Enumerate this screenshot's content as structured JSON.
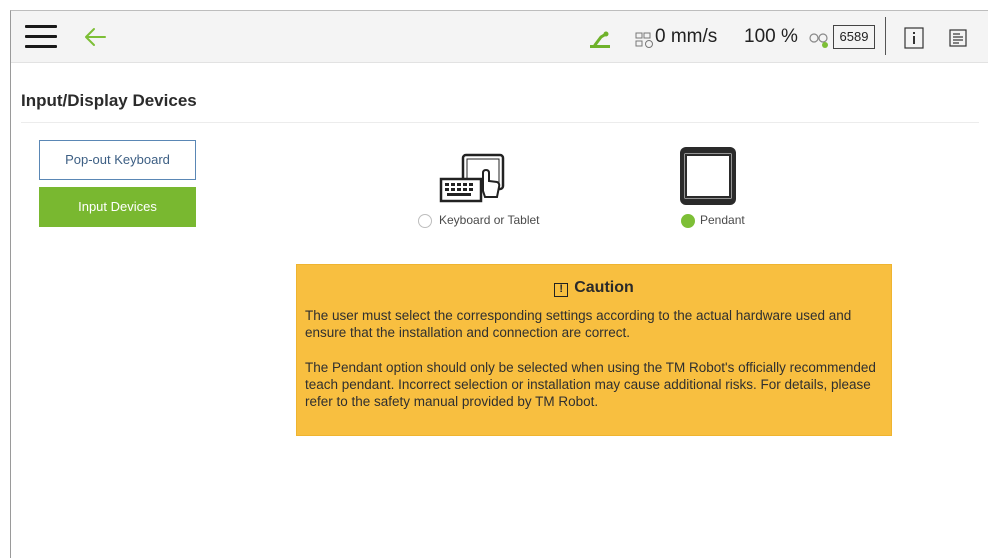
{
  "topbar": {
    "speed": "0 mm/s",
    "percent": "100 %",
    "counter": "6589"
  },
  "page": {
    "title": "Input/Display Devices"
  },
  "nav": {
    "popout_keyboard": "Pop-out Keyboard",
    "input_devices": "Input Devices"
  },
  "devices": {
    "keyboard_label": "Keyboard or Tablet",
    "pendant_label": "Pendant",
    "selected": "Pendant"
  },
  "caution": {
    "title": "Caution",
    "line1": "The user must select the corresponding settings according to the actual hardware used and ensure that the installation and connection are correct.",
    "line2": "The Pendant option should only be selected when using the TM Robot's officially recommended teach pendant. Incorrect selection or installation may cause additional risks. For details, please refer to the safety manual provided by TM Robot."
  },
  "colors": {
    "accent_green": "#79b830",
    "caution_bg": "#f8bf40",
    "nav_outline": "#5a87b5"
  },
  "icons": [
    "menu-icon",
    "back-arrow-icon",
    "robot-arm-icon",
    "speed-icon",
    "connection-icon",
    "info-icon",
    "log-icon",
    "keyboard-tablet-icon",
    "pendant-icon",
    "warning-icon"
  ]
}
